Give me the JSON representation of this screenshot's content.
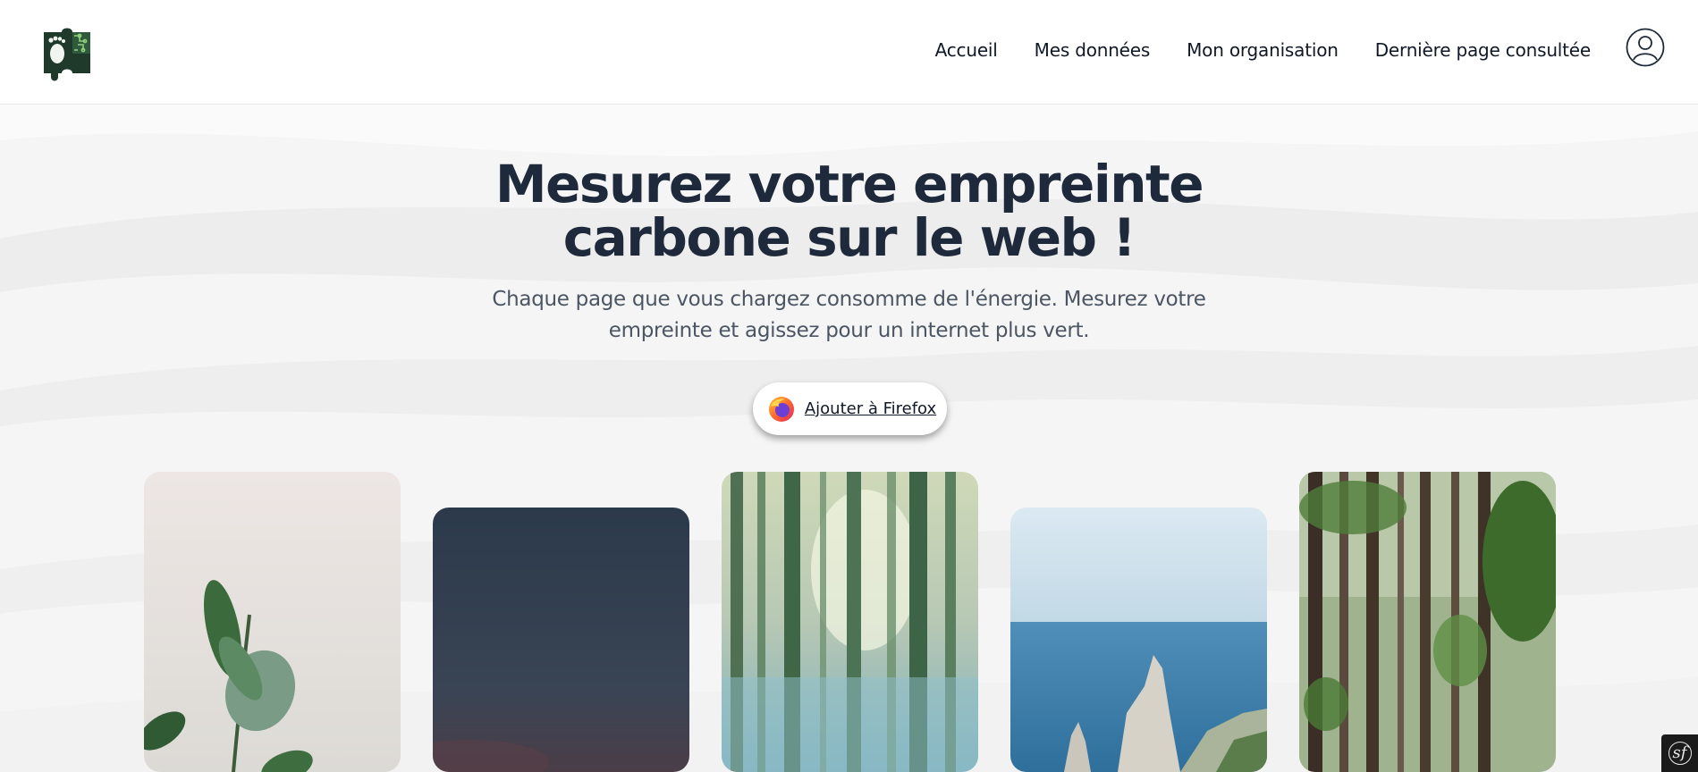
{
  "nav": {
    "items": [
      "Accueil",
      "Mes données",
      "Mon organisation",
      "Dernière page consultée"
    ]
  },
  "hero": {
    "title_line1": "Mesurez votre empreinte",
    "title_line2": "carbone sur le web !",
    "subtitle_line1": "Chaque page que vous chargez consomme de l'énergie. Mesurez votre",
    "subtitle_line2": "empreinte et agissez pour un internet plus vert.",
    "cta_label": "Ajouter à Firefox"
  },
  "gallery": {
    "items": [
      "plant-photo",
      "dusk-sky-photo",
      "misty-forest-photo",
      "sea-cliff-photo",
      "pine-forest-photo"
    ]
  },
  "debug_toolbar": {
    "label": "sf"
  },
  "colors": {
    "title": "#1e2a3b",
    "subtitle": "#4b5563",
    "background": "#f6f6f6",
    "topbar": "#ffffff"
  }
}
